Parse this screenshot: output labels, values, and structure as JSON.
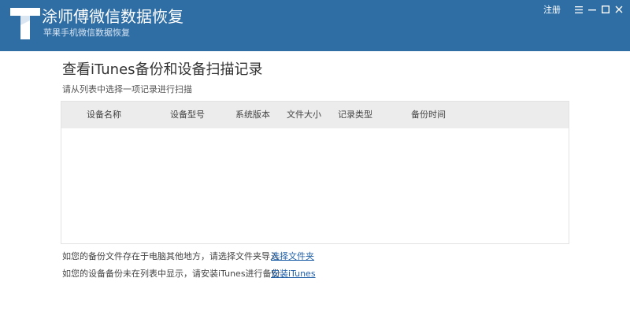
{
  "app": {
    "title": "涂师傅微信数据恢复",
    "subtitle": "苹果手机微信数据恢复",
    "logo_letter": "T",
    "brand_color": "#2f6ea5"
  },
  "window_controls": {
    "register_label": "注册",
    "menu_icon": "menu-icon",
    "minimize_icon": "minimize-icon",
    "maximize_icon": "maximize-icon",
    "close_icon": "close-icon"
  },
  "main": {
    "heading": "查看iTunes备份和设备扫描记录",
    "subheading": "请从列表中选择一项记录进行扫描"
  },
  "table": {
    "columns": [
      "设备名称",
      "设备型号",
      "系统版本",
      "文件大小",
      "记录类型",
      "备份时间"
    ],
    "rows": []
  },
  "hints": [
    {
      "text": "如您的备份文件存在于电脑其他地方，请选择文件夹导入",
      "link": "选择文件夹"
    },
    {
      "text": "如您的设备备份未在列表中显示，请安装iTunes进行备份",
      "link": "安装iTunes"
    }
  ],
  "colors": {
    "link": "#1f5fa8",
    "table_header_bg": "#ececec"
  }
}
